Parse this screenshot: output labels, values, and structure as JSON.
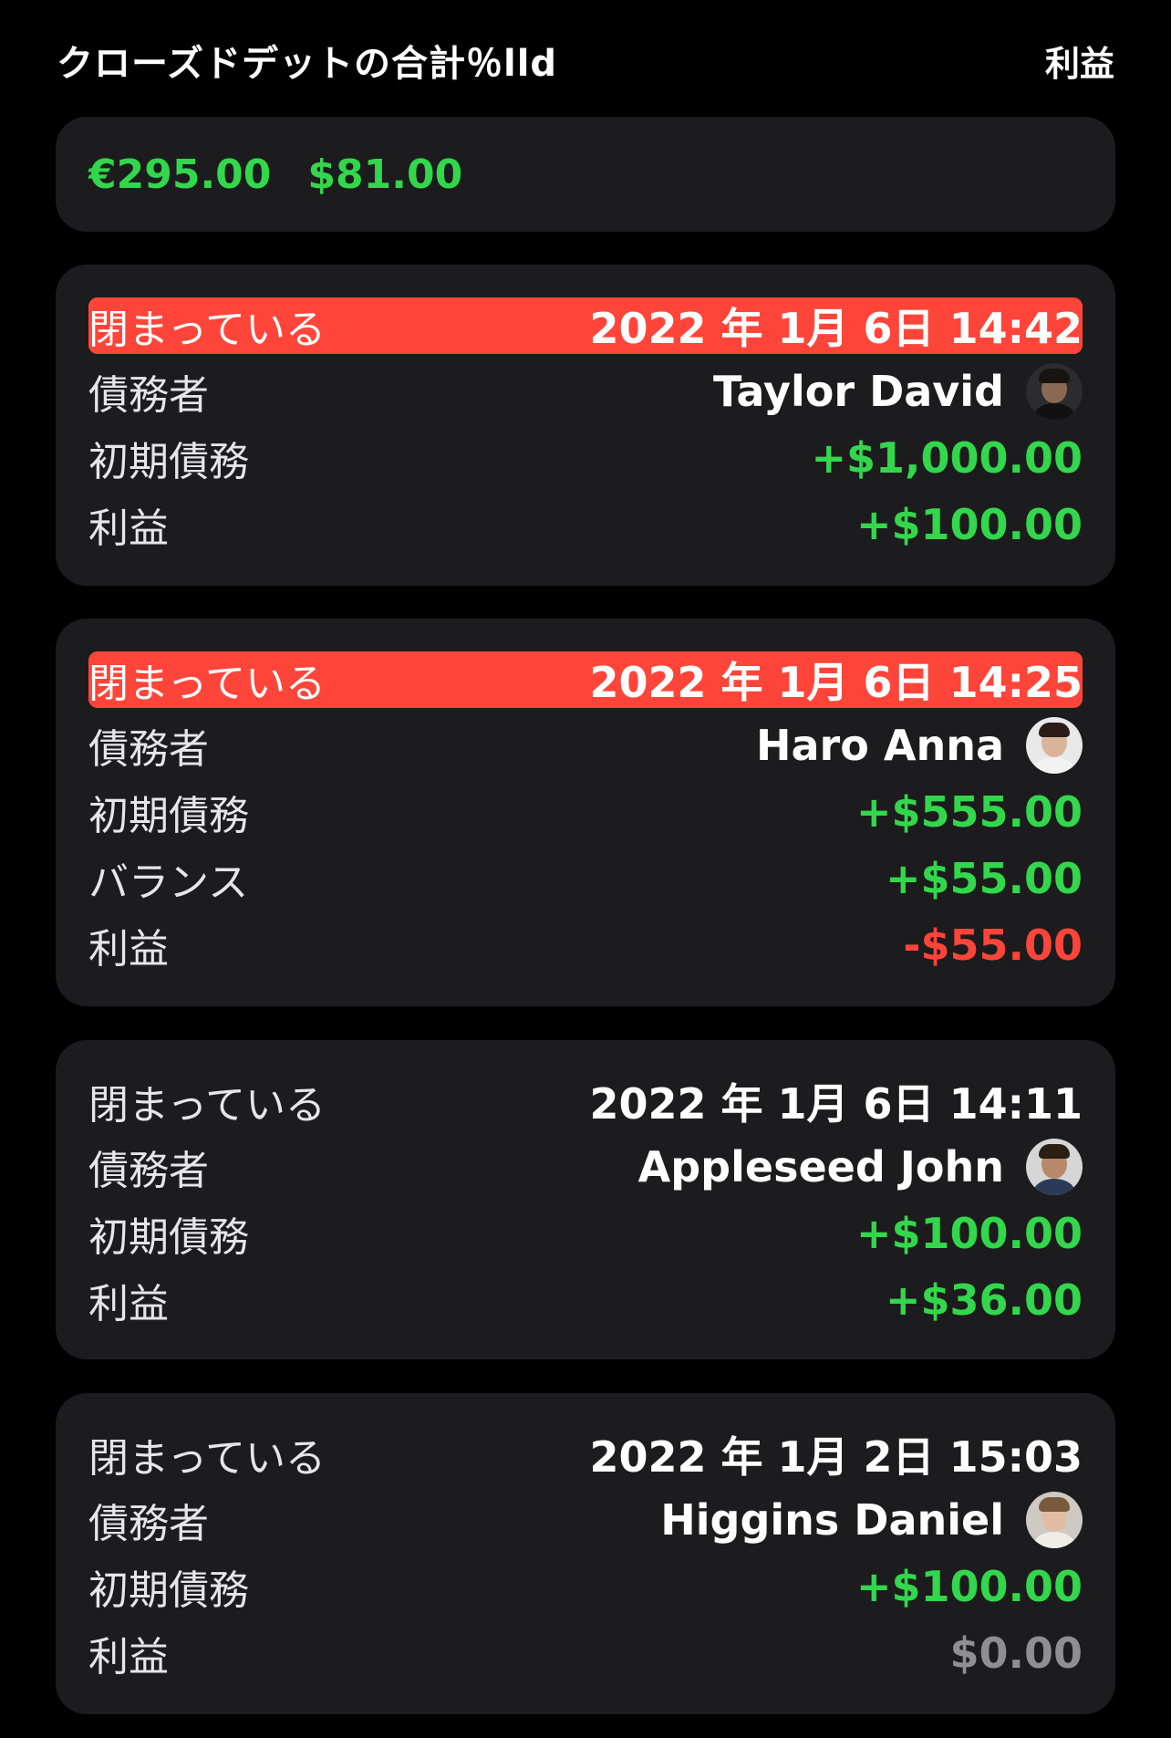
{
  "header": {
    "title": "クローズドデットの合計％lld",
    "sort_label": "利益"
  },
  "summary": {
    "totals": [
      {
        "text": "€295.00",
        "color": "#32d74b"
      },
      {
        "text": "$81.00",
        "color": "#32d74b"
      }
    ]
  },
  "colors": {
    "green": "#32d74b",
    "red": "#ff453a",
    "gray": "#8e8e93",
    "white": "#ffffff"
  },
  "debts": [
    {
      "status_label": "閉まっている",
      "date": "2022 年 1月 6日 14:42",
      "highlight": true,
      "debtor_label": "債務者",
      "debtor_name": "Taylor David",
      "avatar": {
        "bg": "#2c2c2e",
        "skin": "#8a6a55",
        "hair": "#1a1410",
        "shirt": "#111111"
      },
      "rows": [
        {
          "label": "初期債務",
          "value": "+$1,000.00",
          "color": "#32d74b"
        },
        {
          "label": "利益",
          "value": "+$100.00",
          "color": "#32d74b"
        }
      ]
    },
    {
      "status_label": "閉まっている",
      "date": "2022 年 1月 6日 14:25",
      "highlight": true,
      "debtor_label": "債務者",
      "debtor_name": "Haro Anna",
      "avatar": {
        "bg": "#e8e8e8",
        "skin": "#d9b49a",
        "hair": "#2a1d17",
        "shirt": "#f2f2f2"
      },
      "rows": [
        {
          "label": "初期債務",
          "value": "+$555.00",
          "color": "#32d74b"
        },
        {
          "label": "バランス",
          "value": "+$55.00",
          "color": "#32d74b"
        },
        {
          "label": "利益",
          "value": "-$55.00",
          "color": "#ff453a"
        }
      ]
    },
    {
      "status_label": "閉まっている",
      "date": "2022 年 1月 6日 14:11",
      "highlight": false,
      "debtor_label": "債務者",
      "debtor_name": "Appleseed John",
      "avatar": {
        "bg": "#d6d6d6",
        "skin": "#b88a6a",
        "hair": "#2b1e14",
        "shirt": "#2b3b57"
      },
      "rows": [
        {
          "label": "初期債務",
          "value": "+$100.00",
          "color": "#32d74b"
        },
        {
          "label": "利益",
          "value": "+$36.00",
          "color": "#32d74b"
        }
      ]
    },
    {
      "status_label": "閉まっている",
      "date": "2022 年 1月 2日 15:03",
      "highlight": false,
      "debtor_label": "債務者",
      "debtor_name": "Higgins Daniel",
      "avatar": {
        "bg": "#cfc9c4",
        "skin": "#e0bda4",
        "hair": "#7a5a3f",
        "shirt": "#f0ece8"
      },
      "rows": [
        {
          "label": "初期債務",
          "value": "+$100.00",
          "color": "#32d74b"
        },
        {
          "label": "利益",
          "value": "$0.00",
          "color": "#8e8e93"
        }
      ]
    }
  ]
}
